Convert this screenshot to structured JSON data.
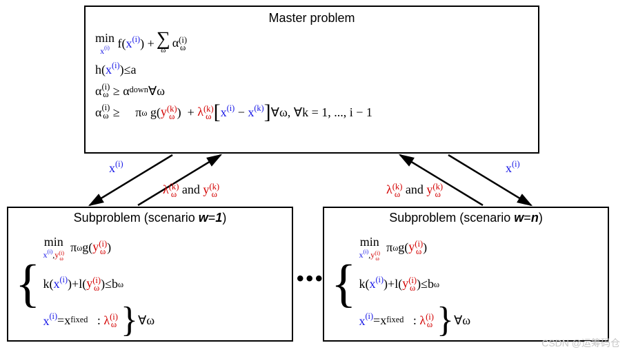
{
  "master": {
    "title": "Master problem",
    "min_label": "min",
    "min_under_var": "x",
    "min_under_sup": "(i)",
    "obj_f": "f",
    "obj_x": "x",
    "obj_x_sup": "(i)",
    "plus": "+",
    "sum_under": "ω",
    "alpha": "α",
    "alpha_sub": "ω",
    "alpha_sup": "(i)",
    "c1_h": "h",
    "c1_x": "x",
    "c1_x_sup": "(i)",
    "c1_le": "≤",
    "c1_rhs": "a",
    "c2_alpha": "α",
    "c2_sub": "ω",
    "c2_sup": "(i)",
    "c2_ge": "≥",
    "c2_rhs": "α",
    "c2_rhs_sup": "down",
    "c2_tail": "  ∀ω",
    "c3_alpha": "α",
    "c3_sub": "ω",
    "c3_sup": "(i)",
    "c3_ge": "≥",
    "c3_pi": "π",
    "c3_pi_sub": "ω",
    "c3_g": "g",
    "c3_y": "y",
    "c3_y_sub": "ω",
    "c3_y_sup": "(k)",
    "c3_plus": "+",
    "c3_lam": "λ",
    "c3_lam_sub": "ω",
    "c3_lam_sup": "(k)",
    "c3_xi": "x",
    "c3_xi_sup": "(i)",
    "c3_minus": "−",
    "c3_xk": "x",
    "c3_xk_sup": "(k)",
    "c3_tail": "  ∀ω, ∀k = 1, ..., i − 1"
  },
  "arrows": {
    "left_down": "x",
    "left_down_sup": "(i)",
    "left_up_lam": "λ",
    "left_up_lam_sub": "ω",
    "left_up_lam_sup": "(k)",
    "left_up_and": " and ",
    "left_up_y": "y",
    "left_up_y_sub": "ω",
    "left_up_y_sup": "(k)",
    "right_down": "x",
    "right_down_sup": "(i)",
    "right_up_lam": "λ",
    "right_up_lam_sub": "ω",
    "right_up_lam_sup": "(k)",
    "right_up_and": " and ",
    "right_up_y": "y",
    "right_up_y_sub": "ω",
    "right_up_y_sup": "(k)"
  },
  "sub1": {
    "title_prefix": "Subproblem (scenario ",
    "title_var": "w",
    "title_eq": "=",
    "title_val": "1",
    "title_suffix": ")",
    "min_label": "min",
    "min_under_x": "x",
    "min_under_x_sup": "(i)",
    "min_under_comma": ",",
    "min_under_y": "y",
    "min_under_y_sub": "ω",
    "min_under_y_sup": "(i)",
    "obj_pi": "π",
    "obj_pi_sub": "ω",
    "obj_g": "g",
    "obj_y": "y",
    "obj_y_sub": "ω",
    "obj_y_sup": "(i)",
    "c1_k": "k",
    "c1_x": "x",
    "c1_x_sup": "(i)",
    "c1_plus": "+",
    "c1_l": "l",
    "c1_y": "y",
    "c1_y_sub": "ω",
    "c1_y_sup": "(i)",
    "c1_le": "≤",
    "c1_rhs": "b",
    "c1_rhs_sub": "ω",
    "c2_x": "x",
    "c2_x_sup": "(i)",
    "c2_eq": "=",
    "c2_xfixed": "x",
    "c2_xfixed_sup": "fixed",
    "c2_colon": ":",
    "c2_lam": "λ",
    "c2_lam_sub": "ω",
    "c2_lam_sup": "(i)",
    "tail": "  ∀ω"
  },
  "sub2": {
    "title_prefix": "Subproblem (scenario ",
    "title_var": "w",
    "title_eq": "=",
    "title_val": "n",
    "title_suffix": ")",
    "min_label": "min",
    "min_under_x": "x",
    "min_under_x_sup": "(i)",
    "min_under_comma": ",",
    "min_under_y": "y",
    "min_under_y_sub": "ω",
    "min_under_y_sup": "(i)",
    "obj_pi": "π",
    "obj_pi_sub": "ω",
    "obj_g": "g",
    "obj_y": "y",
    "obj_y_sub": "ω",
    "obj_y_sup": "(i)",
    "c1_k": "k",
    "c1_x": "x",
    "c1_x_sup": "(i)",
    "c1_plus": "+",
    "c1_l": "l",
    "c1_y": "y",
    "c1_y_sub": "ω",
    "c1_y_sup": "(i)",
    "c1_le": "≤",
    "c1_rhs": "b",
    "c1_rhs_sub": "ω",
    "c2_x": "x",
    "c2_x_sup": "(i)",
    "c2_eq": "=",
    "c2_xfixed": "x",
    "c2_xfixed_sup": "fixed",
    "c2_colon": ":",
    "c2_lam": "λ",
    "c2_lam_sub": "ω",
    "c2_lam_sup": "(i)",
    "tail": "  ∀ω"
  },
  "dots": "•••",
  "watermark": "CSDN @运筹码仓"
}
